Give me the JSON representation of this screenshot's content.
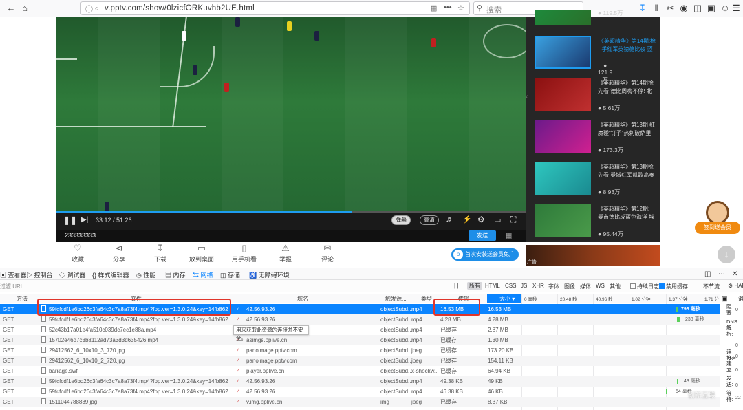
{
  "browser": {
    "url": "v.pptv.com/show/0lzicfORKuvhb2UE.html",
    "search_placeholder": "搜索",
    "more_label": "•••"
  },
  "player": {
    "time": "33:12 / 51:26",
    "progress": 0.63,
    "danmu_button": "弹幕",
    "quality_button": "高清",
    "danmu_text": "233333333",
    "send_button": "发送"
  },
  "recommendations": [
    {
      "title": "",
      "views": "119.5万"
    },
    {
      "title": "《英超精华》第14期:枪手红军英镑德比夜 蓝",
      "views": "121.9万"
    },
    {
      "title": "《英超精华》第14期抢先看 德比周嗨不停! 北",
      "views": "5.61万"
    },
    {
      "title": "《英超精华》第13期 红魔碰“钉子”热刺破萨里",
      "views": "173.3万"
    },
    {
      "title": "《英超精华》第13期抢先看 曼城红军凯歌高奏",
      "views": "8.93万"
    },
    {
      "title": "《英超精华》第12期: 曼市德比成蓝色海洋 埃",
      "views": "95.44万"
    }
  ],
  "actions": [
    {
      "label": "收藏",
      "icon": "heart-icon"
    },
    {
      "label": "分享",
      "icon": "share-icon"
    },
    {
      "label": "下载",
      "icon": "download-icon"
    },
    {
      "label": "放到桌面",
      "icon": "desktop-icon"
    },
    {
      "label": "用手机看",
      "icon": "phone-icon"
    },
    {
      "label": "举报",
      "icon": "report-icon"
    },
    {
      "label": "评论",
      "icon": "comment-icon"
    }
  ],
  "vip_banner": "首次安装送会员免广告",
  "ad_label": "广告",
  "mascot_label": "签到送会员",
  "devtools": {
    "tabs": [
      "查看器",
      "控制台",
      "调试器",
      "样式编辑器",
      "性能",
      "内存",
      "网络",
      "存储",
      "无障碍环境"
    ],
    "selected_tab": "网络",
    "filter_placeholder": "过滤 URL",
    "pause": "| |",
    "types": [
      "所有",
      "HTML",
      "CSS",
      "JS",
      "XHR",
      "字体",
      "图像",
      "媒体",
      "WS",
      "其他"
    ],
    "persist_log": "持续日志",
    "disable_cache": "禁用缓存",
    "throttle": "不节流",
    "har": "HAR",
    "columns": {
      "method": "方法",
      "file": "文件",
      "domain": "域名",
      "cause": "触发源...",
      "type": "类型",
      "transferred": "传输",
      "size": "大小"
    },
    "timeline": [
      "0 毫秒",
      "20.48 秒",
      "40.96 秒",
      "1.02 分钟",
      "1.37 分钟",
      "1.71 分"
    ],
    "tooltip": "用来获取此资源的连接并不安全。",
    "rows": [
      {
        "method": "GET",
        "file": "59fcfcdf1e6bd26c3fa64c3c7a8a73f4.mp4?fpp.ver=1.3.0.24&key=14fb8625...",
        "domain": "42.56.93.26",
        "cause": "objectSubd...",
        "type": "mp4",
        "transferred": "16.53 MB",
        "size": "16.53 MB",
        "timing": "793 毫秒"
      },
      {
        "method": "GET",
        "file": "59fcfcdf1e6bd26c3fa64c3c7a8a73f4.mp4?fpp.ver=1.3.0.24&key=14fb8625...",
        "domain": "42.56.93.26",
        "cause": "objectSubd...",
        "type": "mp4",
        "transferred": "4.28 MB",
        "size": "4.28 MB",
        "timing": "238 毫秒"
      },
      {
        "method": "GET",
        "file": "52c43b17a01e4fa510c039dc7ec1e88a.mp4",
        "domain": "",
        "cause": "objectSubd...",
        "type": "mp4",
        "transferred": "已缓存",
        "size": "2.87 MB",
        "timing": ""
      },
      {
        "method": "GET",
        "file": "15702e46d7c3b8112ad73a3d3d635426.mp4",
        "domain": "asimgs.pplive.cn",
        "cause": "objectSubd...",
        "type": "mp4",
        "transferred": "已缓存",
        "size": "1.30 MB",
        "timing": ""
      },
      {
        "method": "GET",
        "file": "29412562_6_10x10_3_720.jpg",
        "domain": "panoimage.pptv.com",
        "cause": "objectSubd...",
        "type": "jpeg",
        "transferred": "已缓存",
        "size": "173.20 KB",
        "timing": ""
      },
      {
        "method": "GET",
        "file": "29412562_6_10x10_2_720.jpg",
        "domain": "panoimage.pptv.com",
        "cause": "objectSubd...",
        "type": "jpeg",
        "transferred": "已缓存",
        "size": "154.11 KB",
        "timing": ""
      },
      {
        "method": "GET",
        "file": "barrage.swf",
        "domain": "player.pplive.cn",
        "cause": "objectSubd...",
        "type": "x-shockw...",
        "transferred": "已缓存",
        "size": "64.94 KB",
        "timing": ""
      },
      {
        "method": "GET",
        "file": "59fcfcdf1e6bd26c3fa64c3c7a8a73f4.mp4?fpp.ver=1.3.0.24&key=14fb8625...",
        "domain": "42.56.93.26",
        "cause": "objectSubd...",
        "type": "mp4",
        "transferred": "49.38 KB",
        "size": "49 KB",
        "timing": "43 毫秒"
      },
      {
        "method": "GET",
        "file": "59fcfcdf1e6bd26c3fa64c3c7a8a73f4.mp4?fpp.ver=1.3.0.24&key=14fb8625...",
        "domain": "42.56.93.26",
        "cause": "objectSubd...",
        "type": "mp4",
        "transferred": "46.38 KB",
        "size": "46 KB",
        "timing": "54 毫秒"
      },
      {
        "method": "GET",
        "file": "1511044788839.jpg",
        "domain": "v.img.pplive.cn",
        "cause": "img",
        "type": "jpeg",
        "transferred": "已缓存",
        "size": "8.37 KB",
        "timing": ""
      }
    ],
    "detail": {
      "tabs": [
        "消",
        "消"
      ],
      "labels": [
        "阻塞:",
        "DNS 解析:",
        "连接:",
        "TLS 建立:",
        "发送:",
        "等待:"
      ],
      "values": [
        "0",
        "0",
        "0",
        "0",
        "0",
        "22"
      ]
    }
  },
  "watermark": "创新互联"
}
